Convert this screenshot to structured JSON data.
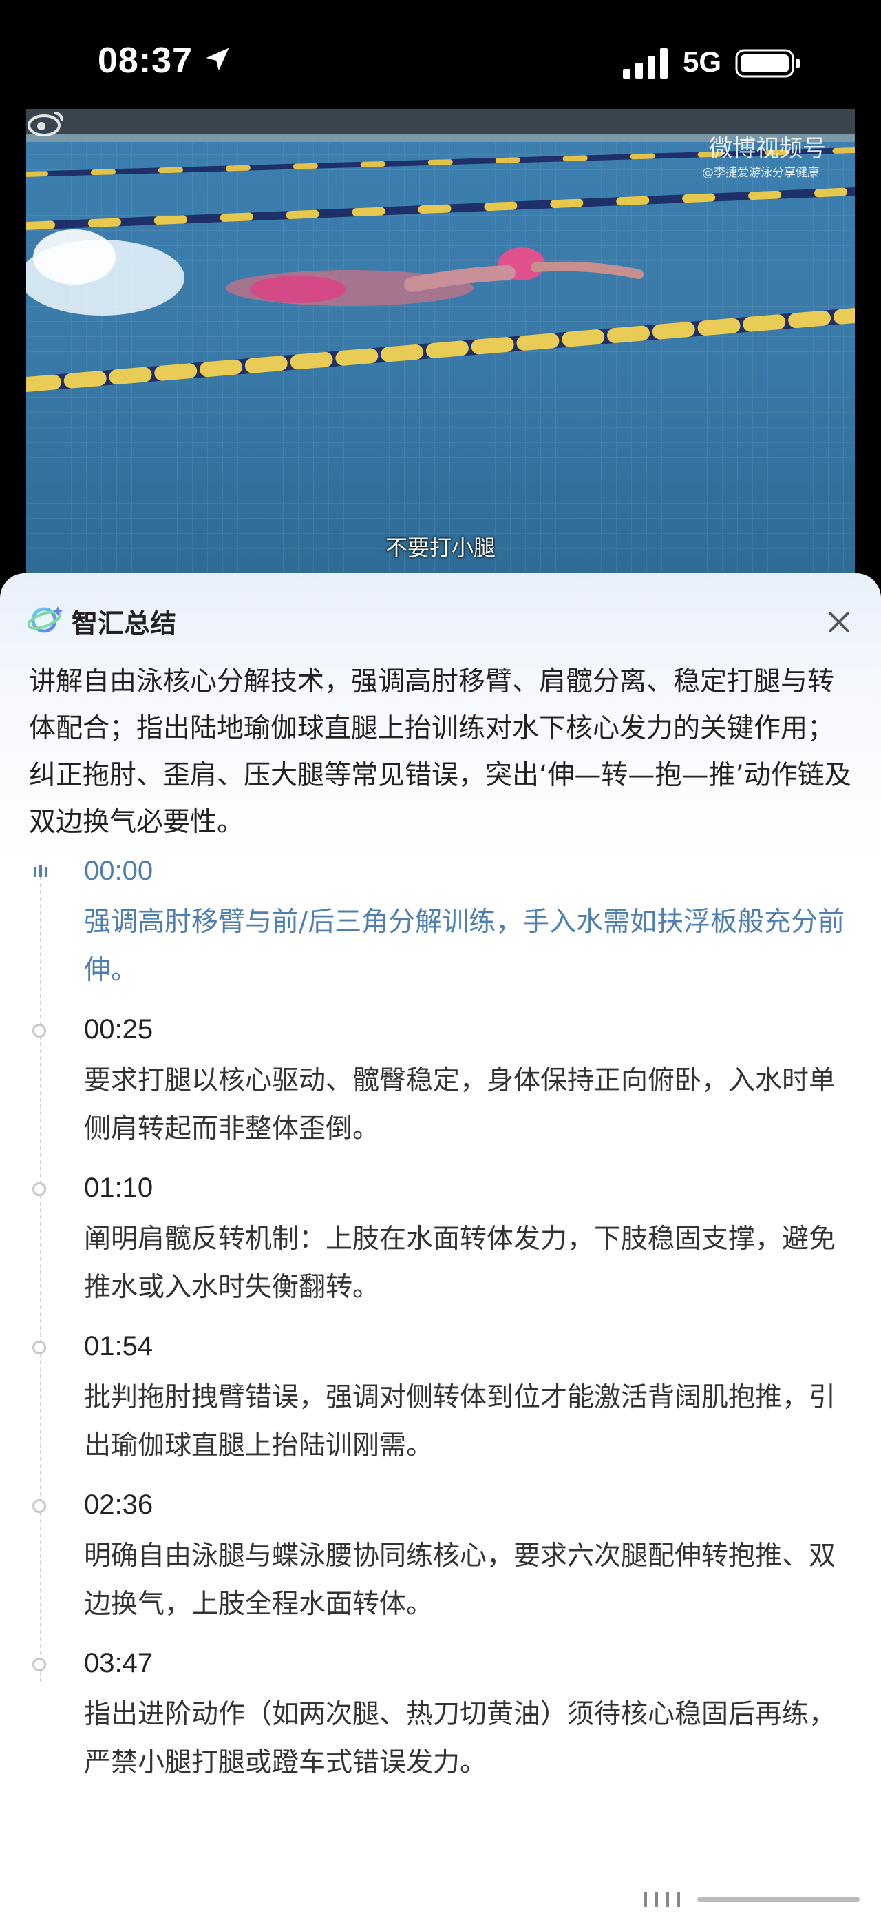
{
  "status_bar": {
    "time": "08:37",
    "network": "5G"
  },
  "video": {
    "watermark_title": "微博视频号",
    "watermark_sub": "@李捷爱游泳分享健康",
    "subtitle": "不要打小腿"
  },
  "panel": {
    "title": "智汇总结",
    "summary": "讲解自由泳核心分解技术，强调高肘移臂、肩髋分离、稳定打腿与转体配合；指出陆地瑜伽球直腿上抬训练对水下核心发力的关键作用；纠正拖肘、歪肩、压大腿等常见错误，突出‘伸—转—抱—推’动作链及双边换气必要性。",
    "timeline": [
      {
        "time": "00:00",
        "text": "强调高肘移臂与前/后三角分解训练，手入水需如扶浮板般充分前伸。",
        "active": true
      },
      {
        "time": "00:25",
        "text": "要求打腿以核心驱动、髋臀稳定，身体保持正向俯卧，入水时单侧肩转起而非整体歪倒。"
      },
      {
        "time": "01:10",
        "text": "阐明肩髋反转机制：上肢在水面转体发力，下肢稳固支撑，避免推水或入水时失衡翻转。"
      },
      {
        "time": "01:54",
        "text": "批判拖肘拽臂错误，强调对侧转体到位才能激活背阔肌抱推，引出瑜伽球直腿上抬陆训刚需。"
      },
      {
        "time": "02:36",
        "text": "明确自由泳腿与蝶泳腰协同练核心，要求六次腿配伸转抱推、双边换气，上肢全程水面转体。"
      },
      {
        "time": "03:47",
        "text": "指出进阶动作（如两次腿、热刀切黄油）须待核心稳固后再练，严禁小腿打腿或蹬车式错误发力。"
      }
    ]
  },
  "icons": {
    "location": "location-arrow-icon",
    "signal": "signal-bars-icon",
    "battery": "battery-icon",
    "brand": "zhihui-logo-icon",
    "close": "close-icon",
    "playing": "playing-bars-icon"
  },
  "colors": {
    "accent": "#4f7fae",
    "text": "#222222",
    "muted_dot": "#c4c8cd"
  }
}
